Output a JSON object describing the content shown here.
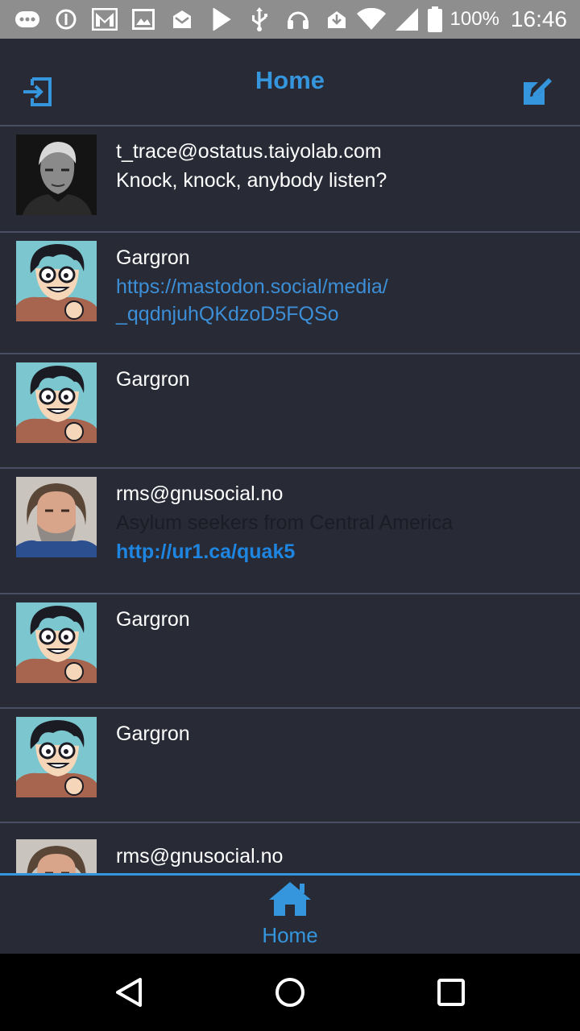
{
  "status_bar": {
    "battery_text": "100%",
    "time": "16:46",
    "icons": [
      "more-icon",
      "info-icon",
      "gmail-icon",
      "image-icon",
      "mail-icon",
      "play-store-icon",
      "usb-icon",
      "headset-icon",
      "download-icon",
      "wifi-icon",
      "signal-icon",
      "battery-icon"
    ]
  },
  "header": {
    "title": "Home",
    "left_icon": "logout-icon",
    "right_icon": "compose-icon"
  },
  "feed": [
    {
      "username": "t_trace@ostatus.taiyolab.com",
      "lines": [
        {
          "text": "Knock, knock, anybody listen?",
          "style": "plain"
        }
      ],
      "avatar": "portrait-grayscale"
    },
    {
      "username": "Gargron",
      "lines": [
        {
          "text": "https://mastodon.social/media/\n_qqdnjuhQKdzoD5FQSo",
          "style": "link"
        }
      ],
      "avatar": "cartoon"
    },
    {
      "username": "Gargron",
      "lines": [],
      "avatar": "cartoon"
    },
    {
      "username": "rms@gnusocial.no",
      "lines": [
        {
          "text": "Asylum seekers from Central America",
          "style": "muted"
        },
        {
          "text": "http://ur1.ca/quak5",
          "style": "boldlink"
        }
      ],
      "avatar": "bearded-man"
    },
    {
      "username": "Gargron",
      "lines": [],
      "avatar": "cartoon"
    },
    {
      "username": "Gargron",
      "lines": [],
      "avatar": "cartoon"
    },
    {
      "username": "rms@gnusocial.no",
      "lines": [],
      "avatar": "bearded-man"
    }
  ],
  "bottom_nav": {
    "home_label": "Home",
    "home_icon": "home-icon"
  },
  "system_nav": {
    "icons": [
      "back-icon",
      "home-circle-icon",
      "recents-icon"
    ]
  },
  "colors": {
    "background": "#282a36",
    "accent": "#3596dd",
    "divider": "#4b4f63",
    "status_bar": "#8e8e8e"
  }
}
